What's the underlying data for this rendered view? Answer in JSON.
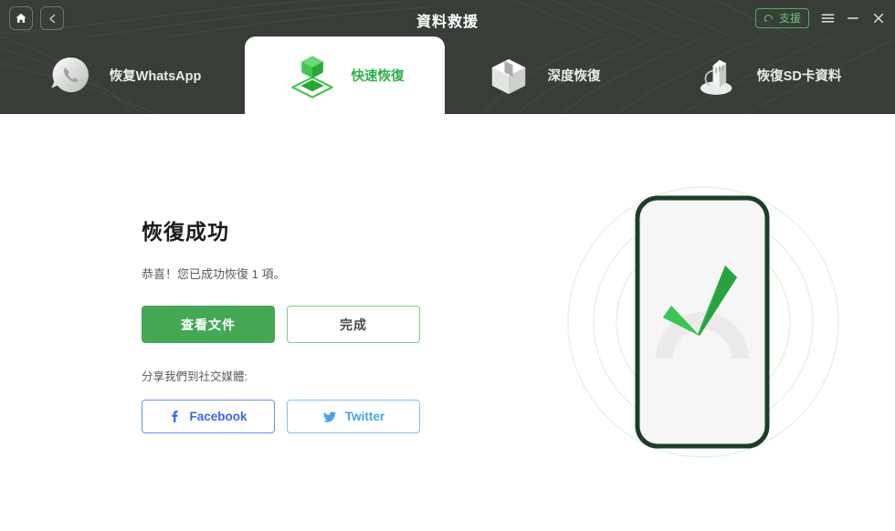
{
  "window": {
    "title": "資料救援",
    "home_icon": "home-icon",
    "back_icon": "chevron-left-icon",
    "support_label": "支援",
    "support_icon": "headset-support-icon",
    "menu_icon": "hamburger-menu-icon",
    "minimize_icon": "minimize-icon",
    "close_icon": "close-icon",
    "accent_green": "#4caf50",
    "header_bg": "#383d38"
  },
  "tabs": [
    {
      "label": "恢复WhatsApp",
      "icon": "whatsapp-phone-bubble-icon",
      "active": false
    },
    {
      "label": "快速恢復",
      "icon": "green-cube-platform-icon",
      "active": true
    },
    {
      "label": "深度恢復",
      "icon": "gray-open-box-icon",
      "active": false
    },
    {
      "label": "恢復SD卡資料",
      "icon": "sd-card-reader-icon",
      "active": false
    }
  ],
  "main": {
    "title": "恢復成功",
    "subtitle": "恭喜！您已成功恢復 1 項。",
    "recovered_count": "1",
    "primary_button": "查看文件",
    "secondary_button": "完成",
    "share_label": "分享我們到社交媒體:",
    "social": [
      {
        "name": "Facebook",
        "icon": "facebook-f-icon",
        "color": "#3b66f0"
      },
      {
        "name": "Twitter",
        "icon": "twitter-bird-icon",
        "color": "#4aa3e8"
      }
    ],
    "illustration": {
      "icon": "phone-with-green-checkmark-illustration",
      "phone_border_color": "#1e3d26",
      "screen_color": "#f5f5f5",
      "check_color": "#2fb148",
      "ring_color": "#e3f6e4"
    }
  }
}
